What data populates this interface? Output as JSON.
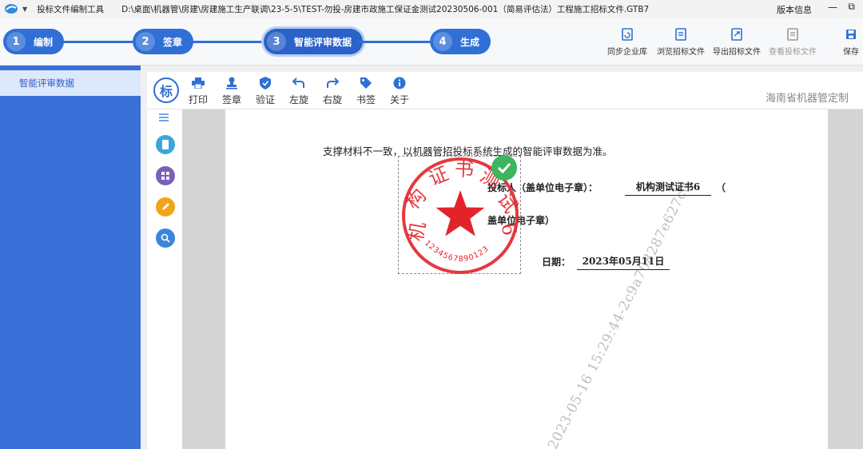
{
  "titlebar": {
    "app_name": "投标文件编制工具",
    "file_path": "D:\\桌面\\机器管\\房建\\房建施工生产联调\\23-5-5\\TEST-勿投-房建市政施工保证金测试20230506-001（简易评估法）工程施工招标文件.GTB7",
    "version_info": "版本信息",
    "minimize_glyph": "—",
    "restore_glyph": "⧉"
  },
  "steps": [
    {
      "num": "1",
      "label": "编制"
    },
    {
      "num": "2",
      "label": "签章"
    },
    {
      "num": "3",
      "label": "智能评审数据"
    },
    {
      "num": "4",
      "label": "生成"
    }
  ],
  "top_actions": [
    {
      "label": "同步企业库",
      "icon": "sync-doc-icon",
      "enabled": true
    },
    {
      "label": "浏览招标文件",
      "icon": "browse-doc-icon",
      "enabled": true
    },
    {
      "label": "导出招标文件",
      "icon": "export-doc-icon",
      "enabled": true
    },
    {
      "label": "查看投标文件",
      "icon": "view-doc-icon",
      "enabled": false
    },
    {
      "label": "保存",
      "icon": "save-icon",
      "enabled": true
    }
  ],
  "sidebar": {
    "items": [
      {
        "label": "智能评审数据",
        "selected": true
      }
    ]
  },
  "doc_toolbar": {
    "logo_glyph": "标",
    "buttons": [
      {
        "label": "打印",
        "icon": "print-icon"
      },
      {
        "label": "签章",
        "icon": "stamp-icon"
      },
      {
        "label": "验证",
        "icon": "shield-icon"
      },
      {
        "label": "左旋",
        "icon": "rotate-left-icon"
      },
      {
        "label": "右旋",
        "icon": "rotate-right-icon"
      },
      {
        "label": "书签",
        "icon": "bookmark-icon"
      },
      {
        "label": "关于",
        "icon": "info-icon"
      }
    ],
    "custom_label": "海南省机器管定制"
  },
  "left_tools": [
    {
      "icon": "menu-icon"
    },
    {
      "icon": "page-icon",
      "color": "#3ba7d8"
    },
    {
      "icon": "grid-icon",
      "color": "#7b5fb8"
    },
    {
      "icon": "pen-icon",
      "color": "#f0a418"
    },
    {
      "icon": "zoom-icon",
      "color": "#3a86d8"
    }
  ],
  "document": {
    "intro_text": "支撑材料不一致，以机器管招投标系统生成的智能评审数据为准。",
    "bidder_label": "投标人（盖单位电子章）：",
    "bidder_value": "机构测试证书6",
    "paren_open": "（",
    "seal_label": "盖单位电子章）",
    "date_label": "日期：",
    "date_value": "2023年05月11日",
    "watermark": "2023-05-16 15:29:44-2c9a708287e627c0"
  },
  "seal": {
    "text_arc": [
      "机",
      "构",
      "证",
      "书",
      "测",
      "试",
      "6"
    ],
    "serial": "1234567890123",
    "color": "#e2232a",
    "verified_check": "✓"
  },
  "colors": {
    "accent": "#2f6fd6",
    "sidebar": "#3a6fd8",
    "seal": "#e2232a",
    "check": "#3cb55e"
  }
}
